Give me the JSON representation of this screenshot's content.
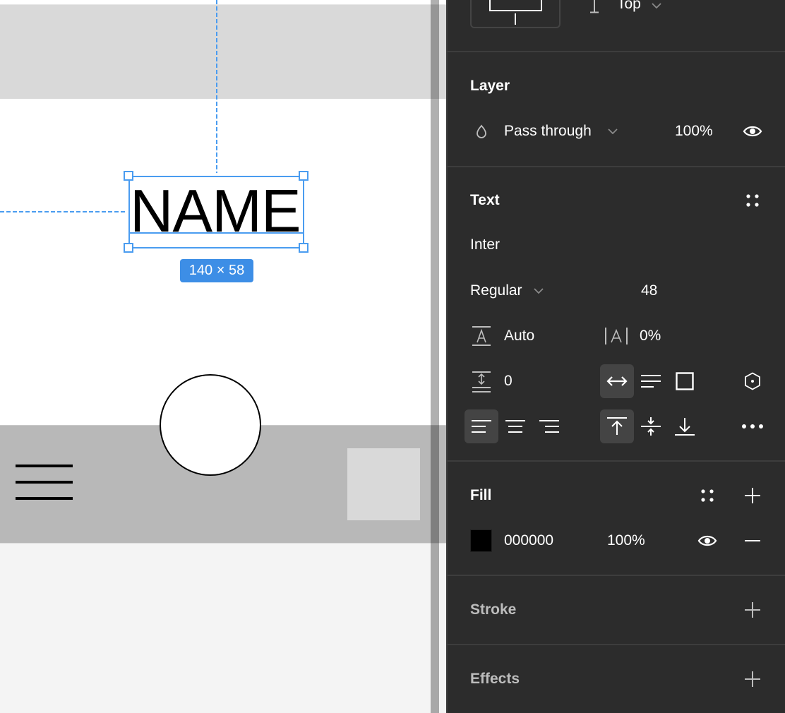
{
  "canvas": {
    "text_layer": "NAME",
    "size_label": "140 × 58",
    "colors": {
      "selection": "#4a9cf0",
      "size_label_bg": "#3d8ee6",
      "top_band": "#d9d9d9",
      "bottom_bar": "#b8b8b8",
      "background": "#f4f4f4"
    }
  },
  "panel": {
    "constraints": {
      "vertical_value": "Top"
    },
    "layer": {
      "title": "Layer",
      "blend_mode": "Pass through",
      "opacity": "100%"
    },
    "text": {
      "title": "Text",
      "font_family": "Inter",
      "font_weight": "Regular",
      "font_size": "48",
      "line_height": "Auto",
      "letter_spacing": "0%",
      "paragraph_spacing": "0",
      "resizing_selected": "auto-width",
      "horizontal_align_selected": "left",
      "vertical_align_selected": "top"
    },
    "fill": {
      "title": "Fill",
      "color_hex": "000000",
      "swatch_color": "#000000",
      "opacity": "100%"
    },
    "stroke": {
      "title": "Stroke"
    },
    "effects": {
      "title": "Effects"
    }
  }
}
